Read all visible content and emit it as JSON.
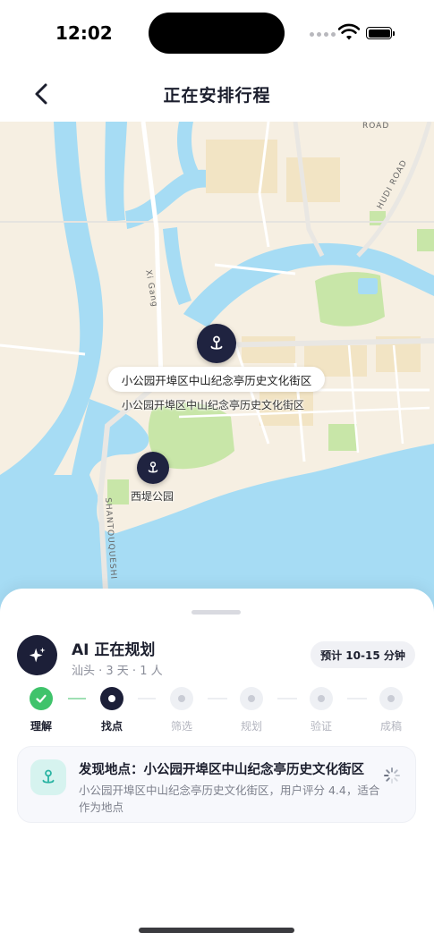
{
  "status_bar": {
    "time": "12:02"
  },
  "nav": {
    "title": "正在安排行程",
    "back_icon": "chevron-left-icon"
  },
  "map": {
    "main_place_bubble": "小公园开埠区中山纪念亭历史文化街区",
    "main_place_label": "小公园开埠区中山纪念亭历史文化街区",
    "second_place_label": "西堤公园",
    "road_labels": {
      "xi_gang": "Xi Gang",
      "hudi_road": "HUDI ROAD",
      "road": "ROAD",
      "shantouqueshi": "SHANTOUQUESHI"
    },
    "colors": {
      "water": "#a6dcf4",
      "land": "#f6efe2",
      "park": "#c8e6a8",
      "pin": "#1f2340"
    }
  },
  "planner": {
    "title": "AI 正在规划",
    "subtitle": "汕头 · 3 天 · 1 人",
    "eta": "预计 10-15 分钟",
    "avatar_icon": "sparkle-icon",
    "steps": [
      {
        "label": "理解",
        "state": "done"
      },
      {
        "label": "找点",
        "state": "current"
      },
      {
        "label": "筛选",
        "state": "pending"
      },
      {
        "label": "规划",
        "state": "pending"
      },
      {
        "label": "验证",
        "state": "pending"
      },
      {
        "label": "成稿",
        "state": "pending"
      }
    ],
    "finding": {
      "title": "发现地点：小公园开埠区中山纪念亭历史文化街区",
      "description": "小公园开埠区中山纪念亭历史文化街区，用户评分 4.4，适合作为地点",
      "icon": "map-pin-icon",
      "status_icon": "loading-spinner-icon"
    },
    "colors": {
      "done": "#3fc36b",
      "current": "#1c1f38",
      "pending": "#eef0f4"
    }
  }
}
